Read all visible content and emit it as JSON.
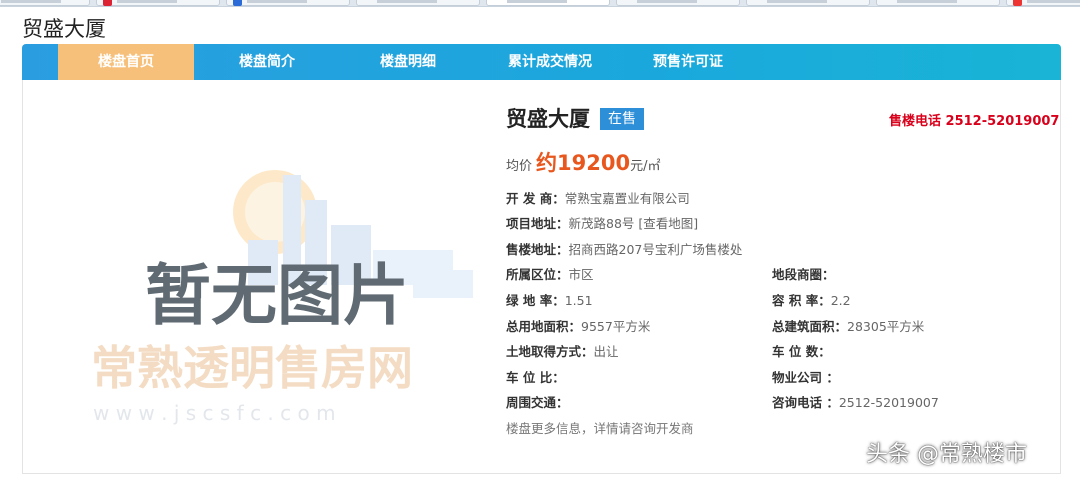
{
  "page_title": "贸盛大厦",
  "nav": {
    "items": [
      {
        "label": "楼盘首页",
        "active": true
      },
      {
        "label": "楼盘简介",
        "active": false
      },
      {
        "label": "楼盘明细",
        "active": false
      },
      {
        "label": "累计成交情况",
        "active": false
      },
      {
        "label": "预售许可证",
        "active": false
      }
    ]
  },
  "placeholder": {
    "main_text": "暂无图片",
    "site_name": "常熟透明售房网",
    "url_text": "w w w . j s c s f c . c o m"
  },
  "building": {
    "name": "贸盛大厦",
    "status": "在售",
    "sales_phone": "售楼电话 2512-52019007",
    "price_label": "均价",
    "price_value": "约19200",
    "price_unit": "元/㎡"
  },
  "details": {
    "developer": {
      "label": "开 发 商：",
      "value": "常熟宝嘉置业有限公司"
    },
    "address": {
      "label": "项目地址：",
      "value": "新茂路88号",
      "link": "[查看地图]"
    },
    "sales_address": {
      "label": "售楼地址：",
      "value": "招商西路207号宝利广场售楼处"
    },
    "district": {
      "label": "所属区位：",
      "value": "市区"
    },
    "business_circle": {
      "label": "地段商圈：",
      "value": ""
    },
    "greening_rate": {
      "label": "绿 地 率：",
      "value": "1.51"
    },
    "plot_ratio": {
      "label": "容 积 率：",
      "value": "2.2"
    },
    "land_area": {
      "label": "总用地面积：",
      "value": "9557平方米"
    },
    "building_area": {
      "label": "总建筑面积：",
      "value": "28305平方米"
    },
    "land_method": {
      "label": "土地取得方式：",
      "value": "出让"
    },
    "parking_count": {
      "label": "车 位 数：",
      "value": ""
    },
    "parking_ratio": {
      "label": "车 位 比：",
      "value": ""
    },
    "property_company": {
      "label": "物业公司 ：",
      "value": ""
    },
    "transport": {
      "label": "周围交通：",
      "value": ""
    },
    "consult_phone": {
      "label": "咨询电话 ：",
      "value": "2512-52019007"
    }
  },
  "note": "楼盘更多信息，详情请咨询开发商",
  "watermark": "头条 @常熟楼市",
  "colors": {
    "nav_blue": "#1aa8dc",
    "nav_active": "#f7c07a",
    "badge_blue": "#2d8fd8",
    "price_orange": "#e8581e",
    "phone_red": "#d9001b"
  }
}
